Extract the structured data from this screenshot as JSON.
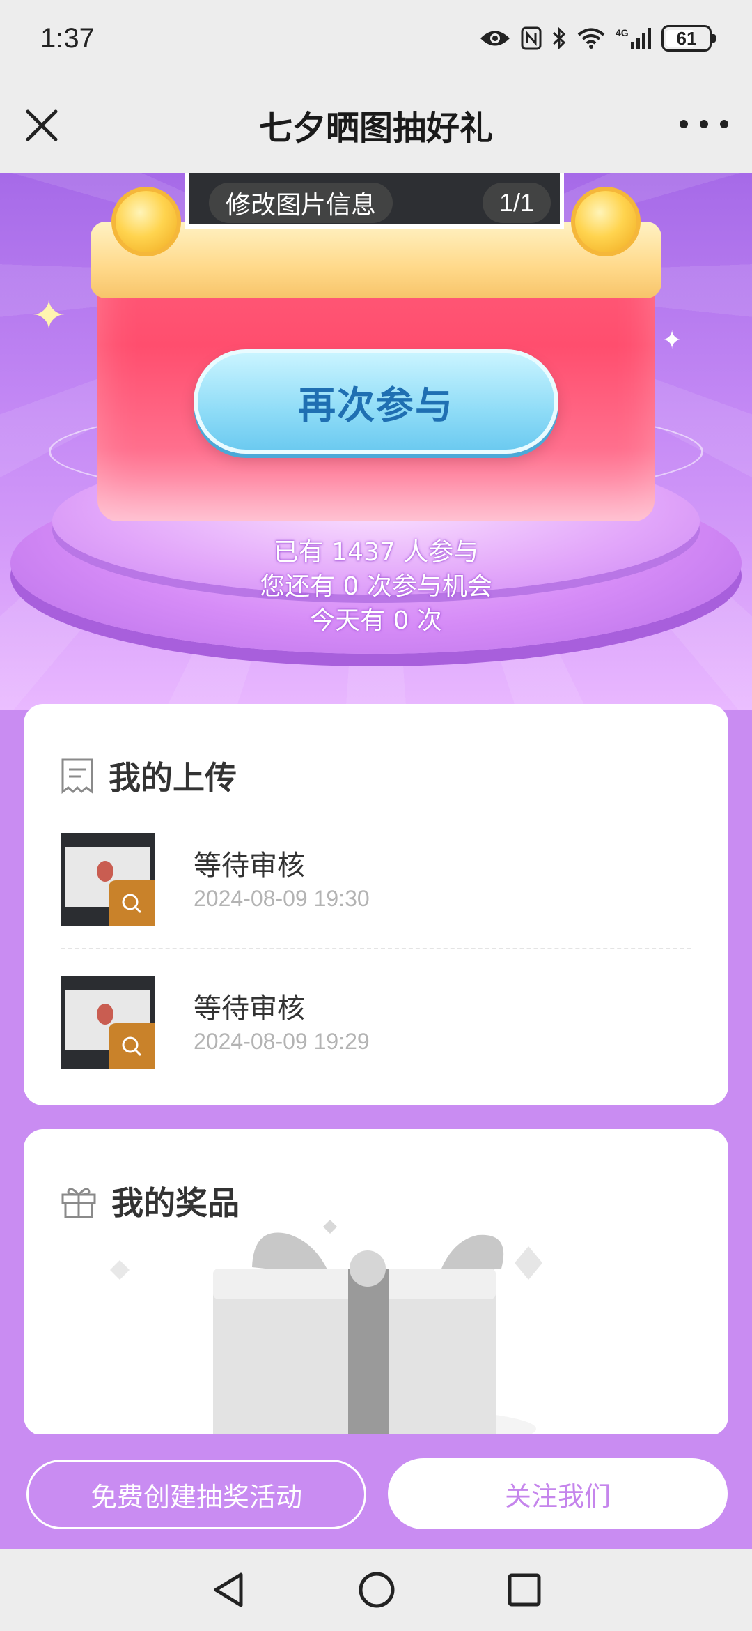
{
  "status_bar": {
    "time": "1:37",
    "battery": "61",
    "icons": [
      "eye-icon",
      "nfc-icon",
      "bluetooth-icon",
      "wifi-icon",
      "signal-4g-icon",
      "battery-icon"
    ]
  },
  "title_bar": {
    "title": "七夕晒图抽好礼",
    "close_icon": "close-icon",
    "more_icon": "more-icon"
  },
  "hero": {
    "modify_label": "修改图片信息",
    "page_indicator": "1/1",
    "rejoin_label": "再次参与",
    "stats": {
      "participants": "已有 1437 人参与",
      "chances_left": "您还有 0 次参与机会",
      "today": "今天有 0 次"
    }
  },
  "uploads": {
    "title": "我的上传",
    "icon": "receipt-icon",
    "items": [
      {
        "status": "等待审核",
        "time": "2024-08-09 19:30"
      },
      {
        "status": "等待审核",
        "time": "2024-08-09 19:29"
      }
    ]
  },
  "prizes": {
    "title": "我的奖品",
    "icon": "gift-icon"
  },
  "actions": {
    "create_label": "免费创建抽奖活动",
    "follow_label": "关注我们"
  },
  "nav_bar": {
    "icons": [
      "back-icon",
      "home-icon",
      "recents-icon"
    ]
  },
  "colors": {
    "accent_purple": "#c98cf2",
    "rejoin_text": "#1f6fb2",
    "follow_text": "#c585ec",
    "box_red": "#ff4e6e"
  }
}
